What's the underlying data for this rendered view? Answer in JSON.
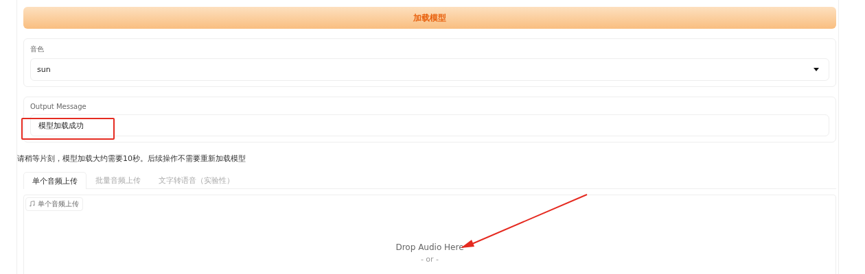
{
  "load_button": {
    "label": "加载模型"
  },
  "voice": {
    "label": "音色",
    "value": "sun"
  },
  "output": {
    "label": "Output Message",
    "value": "模型加载成功",
    "highlighted": true
  },
  "note": "请稍等片刻，模型加载大约需要10秒。后续操作不需要重新加载模型",
  "tabs": [
    {
      "label": "单个音频上传",
      "selected": true
    },
    {
      "label": "批量音频上传",
      "selected": false
    },
    {
      "label": "文字转语音（实验性）",
      "selected": false
    }
  ],
  "upload": {
    "label": "单个音频上传",
    "drop_text": "Drop Audio Here",
    "or_text": "- or -"
  }
}
